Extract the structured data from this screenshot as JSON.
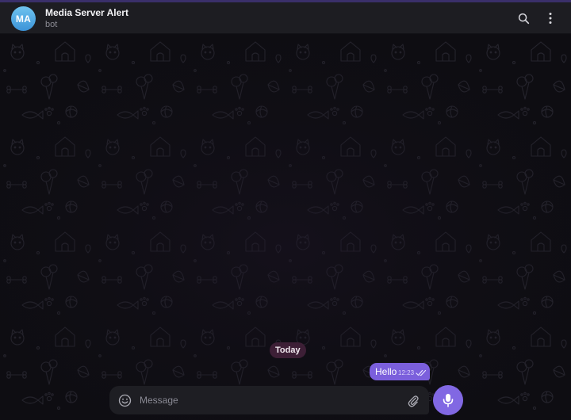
{
  "header": {
    "avatar_initials": "MA",
    "chat_title": "Media Server Alert",
    "chat_subtitle": "bot",
    "search_icon": "search-icon",
    "more_icon": "more-vertical-icon"
  },
  "chat": {
    "date_separator": "Today",
    "messages": [
      {
        "text": "Hello",
        "time": "12:23",
        "direction": "outgoing",
        "status_icon": "double-check-icon"
      }
    ]
  },
  "composer": {
    "placeholder": "Message",
    "value": "",
    "emoji_icon": "emoji-icon",
    "attach_icon": "paperclip-icon",
    "send_icon": "microphone-icon"
  },
  "colors": {
    "accent": "#8168e3",
    "bubble": "#7b5fdc",
    "header_bg": "#1d1d22",
    "chat_bg": "#0e0d12",
    "date_pill": "#3d1f36",
    "avatar_gradient_top": "#6fc4ef",
    "avatar_gradient_bottom": "#3c93d8"
  }
}
